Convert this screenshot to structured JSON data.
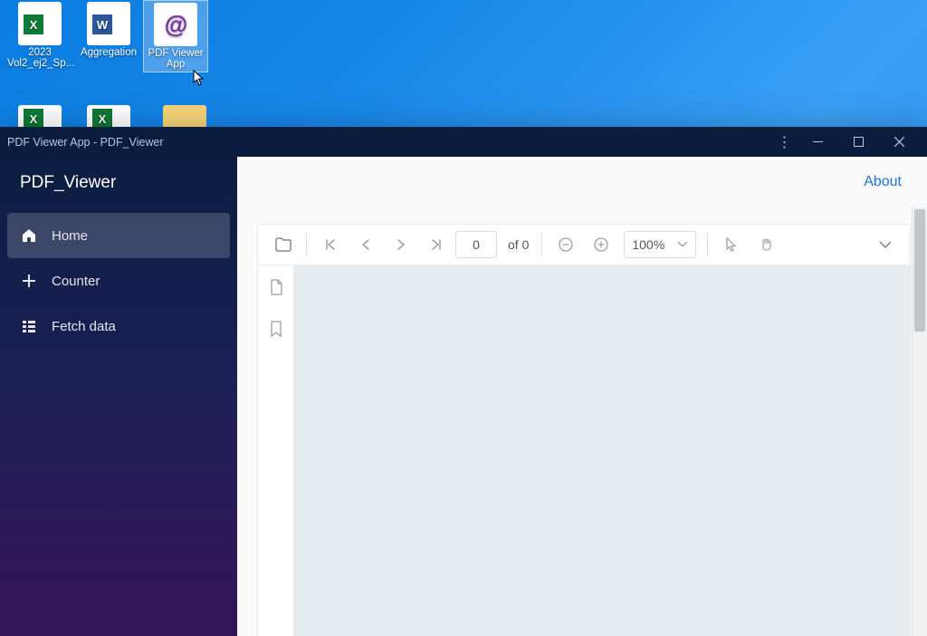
{
  "desktop": {
    "icons": [
      {
        "label": "2023 Vol2_ej2_Sp...",
        "kind": "excel"
      },
      {
        "label": "Aggregation",
        "kind": "word"
      },
      {
        "label": "PDF Viewer App",
        "kind": "pdfapp",
        "selected": true
      }
    ],
    "partial_icons_row2": true
  },
  "window": {
    "title": "PDF Viewer App - PDF_Viewer",
    "controls": {
      "more": "⋮",
      "min": "—",
      "max": "▭",
      "close": "✕"
    }
  },
  "sidebar": {
    "brand": "PDF_Viewer",
    "items": [
      {
        "label": "Home",
        "icon": "home-icon",
        "active": true
      },
      {
        "label": "Counter",
        "icon": "plus-icon",
        "active": false
      },
      {
        "label": "Fetch data",
        "icon": "list-icon",
        "active": false
      }
    ]
  },
  "topbar": {
    "about": "About"
  },
  "viewer": {
    "toolbar": {
      "page_value": "0",
      "page_total_label": "of 0",
      "zoom_label": "100%"
    }
  }
}
